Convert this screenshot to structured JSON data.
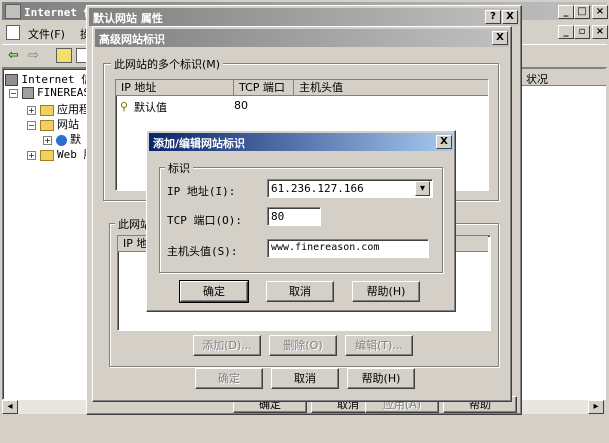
{
  "mmc": {
    "title": "Internet 信",
    "menu_file": "文件(F)",
    "menu_action": "操",
    "tree": [
      "Internet 信",
      "FINEREAS",
      "应用程",
      "网站",
      "默",
      "Web 服"
    ],
    "right_header": "状况",
    "ok": "确定",
    "cancel": "取消",
    "apply": "应用(A)",
    "help": "帮助"
  },
  "props": {
    "title": "默认网站 属性",
    "help_btn": "?",
    "close_btn": "X"
  },
  "adv": {
    "title": "高级网站标识",
    "group1_label": "此网站的多个标识(M)",
    "col_ip": "IP 地址",
    "col_port": "TCP 端口",
    "col_host": "主机头值",
    "row_ip": "默认值",
    "row_port": "80",
    "group2_label": "此网站",
    "group2_col_ip": "IP 地",
    "add_btn": "添加(D)...",
    "remove_btn": "删除(O)",
    "edit_btn": "编辑(T)...",
    "ok": "确定",
    "cancel": "取消",
    "help": "帮助(H)"
  },
  "edit": {
    "title": "添加/编辑网站标识",
    "group_label": "标识",
    "ip_label": "IP 地址(I):",
    "ip_value": "61.236.127.166",
    "port_label": "TCP 端口(O):",
    "port_value": "80",
    "host_label": "主机头值(S):",
    "host_value": "www.finereason.com",
    "ok": "确定",
    "cancel": "取消",
    "help": "帮助(H)"
  }
}
